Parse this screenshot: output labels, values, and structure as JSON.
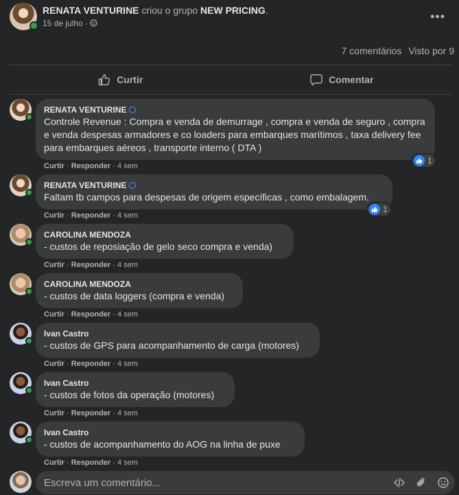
{
  "post": {
    "author": "RENATA VENTURINE",
    "action": "criou o grupo",
    "group": "NEW PRICING",
    "period": ".",
    "date": "15 de julho",
    "separator": "·",
    "comments_count": "7 comentários",
    "seen_by": "Visto por 9"
  },
  "actions": {
    "like": "Curtir",
    "comment": "Comentar"
  },
  "comment_meta": {
    "like": "Curtir",
    "reply": "Responder",
    "dot": "·"
  },
  "comments": [
    {
      "name": "RENATA VENTURINE",
      "verified": true,
      "text": "Controle Revenue : Compra e venda de demurrage , compra e venda de seguro , compra e venda despesas armadores e co loaders para embarques marítimos , taxa delivery fee para embarques aéreos , transporte interno ( DTA )",
      "time": "4 sem",
      "reactions": "1"
    },
    {
      "name": "RENATA VENTURINE",
      "verified": true,
      "text": "Faltam tb campos para despesas de origem específicas , como embalagem.",
      "time": "4 sem",
      "reactions": "1"
    },
    {
      "name": "CAROLINA MENDOZA",
      "verified": false,
      "text": "- custos de reposiação de gelo seco compra e venda)",
      "time": "4 sem"
    },
    {
      "name": "CAROLINA MENDOZA",
      "verified": false,
      "text": "- custos de data loggers (compra e venda)",
      "time": "4 sem"
    },
    {
      "name": "Ivan Castro",
      "verified": false,
      "text": "- custos de GPS para acompanhamento de carga (motores)",
      "time": "4 sem"
    },
    {
      "name": "Ivan Castro",
      "verified": false,
      "text": "- custos de fotos da operação (motores)",
      "time": "4 sem"
    },
    {
      "name": "Ivan Castro",
      "verified": false,
      "text": "- custos de acompanhamento do AOG na linha de puxe",
      "time": "4 sem"
    }
  ],
  "composer": {
    "placeholder": "Escreva um comentário..."
  },
  "colors": {
    "background": "#242526",
    "bubble": "#3a3b3c",
    "online": "#31a24c",
    "like": "#2d88ff"
  }
}
